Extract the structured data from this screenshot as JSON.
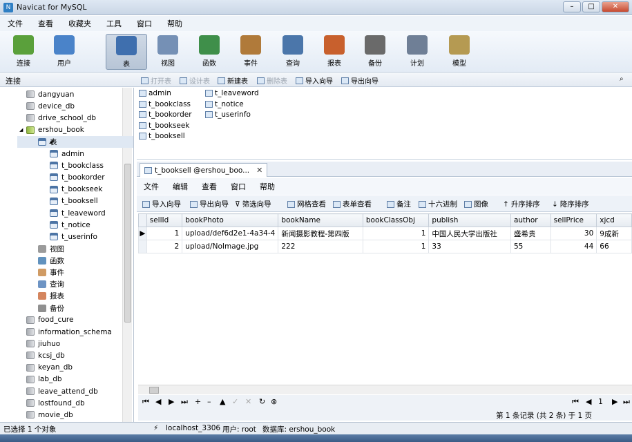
{
  "window": {
    "title": "Navicat for MySQL"
  },
  "menu": [
    "文件",
    "查看",
    "收藏夹",
    "工具",
    "窗口",
    "帮助"
  ],
  "toolbar": [
    {
      "label": "连接",
      "icon": "plug-icon",
      "color": "#5aa03b"
    },
    {
      "label": "用户",
      "icon": "user-icon",
      "color": "#4a83c9"
    },
    {
      "label": "表",
      "icon": "table-icon",
      "color": "#3f6fae",
      "active": true
    },
    {
      "label": "视图",
      "icon": "view-icon",
      "color": "#7590b5"
    },
    {
      "label": "函数",
      "icon": "function-icon",
      "color": "#3f8f4a"
    },
    {
      "label": "事件",
      "icon": "clock-icon",
      "color": "#b07a3a"
    },
    {
      "label": "查询",
      "icon": "query-icon",
      "color": "#4b76aa"
    },
    {
      "label": "报表",
      "icon": "report-icon",
      "color": "#c8602d"
    },
    {
      "label": "备份",
      "icon": "backup-icon",
      "color": "#6a6a6a"
    },
    {
      "label": "计划",
      "icon": "calendar-icon",
      "color": "#6f7f96"
    },
    {
      "label": "模型",
      "icon": "model-icon",
      "color": "#b59a52"
    }
  ],
  "objbar": {
    "conn_label": "连接",
    "buttons": [
      {
        "label": "打开表",
        "enabled": false
      },
      {
        "label": "设计表",
        "enabled": false
      },
      {
        "label": "新建表",
        "enabled": true
      },
      {
        "label": "删除表",
        "enabled": false
      },
      {
        "label": "导入向导",
        "enabled": true
      },
      {
        "label": "导出向导",
        "enabled": true
      }
    ]
  },
  "tree": [
    {
      "label": "dangyuan",
      "kind": "db",
      "level": 1
    },
    {
      "label": "device_db",
      "kind": "db",
      "level": 1
    },
    {
      "label": "drive_school_db",
      "kind": "db",
      "level": 1
    },
    {
      "label": "ershou_book",
      "kind": "db-open",
      "level": 1
    },
    {
      "label": "表",
      "kind": "folder",
      "level": 2
    },
    {
      "label": "admin",
      "kind": "table",
      "level": 3
    },
    {
      "label": "t_bookclass",
      "kind": "table",
      "level": 3
    },
    {
      "label": "t_bookorder",
      "kind": "table",
      "level": 3
    },
    {
      "label": "t_bookseek",
      "kind": "table",
      "level": 3
    },
    {
      "label": "t_booksell",
      "kind": "table",
      "level": 3
    },
    {
      "label": "t_leaveword",
      "kind": "table",
      "level": 3
    },
    {
      "label": "t_notice",
      "kind": "table",
      "level": 3
    },
    {
      "label": "t_userinfo",
      "kind": "table",
      "level": 3
    },
    {
      "label": "视图",
      "kind": "view",
      "level": 2
    },
    {
      "label": "函数",
      "kind": "func",
      "level": 2
    },
    {
      "label": "事件",
      "kind": "event",
      "level": 2
    },
    {
      "label": "查询",
      "kind": "query",
      "level": 2
    },
    {
      "label": "报表",
      "kind": "report",
      "level": 2
    },
    {
      "label": "备份",
      "kind": "backup",
      "level": 2
    },
    {
      "label": "food_cure",
      "kind": "db",
      "level": 1
    },
    {
      "label": "information_schema",
      "kind": "db",
      "level": 1
    },
    {
      "label": "jiuhuo",
      "kind": "db",
      "level": 1
    },
    {
      "label": "kcsj_db",
      "kind": "db",
      "level": 1
    },
    {
      "label": "keyan_db",
      "kind": "db",
      "level": 1
    },
    {
      "label": "lab_db",
      "kind": "db",
      "level": 1
    },
    {
      "label": "leave_attend_db",
      "kind": "db",
      "level": 1
    },
    {
      "label": "lostfound_db",
      "kind": "db",
      "level": 1
    },
    {
      "label": "movie_db",
      "kind": "db",
      "level": 1
    }
  ],
  "objects": {
    "col1": [
      "admin",
      "t_bookclass",
      "t_bookorder",
      "t_bookseek",
      "t_booksell"
    ],
    "col2": [
      "t_leaveword",
      "t_notice",
      "t_userinfo"
    ]
  },
  "tab": {
    "label": "t_booksell @ershou_boo...",
    "close": "✕"
  },
  "inner_menu": [
    "文件",
    "编辑",
    "查看",
    "窗口",
    "帮助"
  ],
  "inner_toolbar": [
    "导入向导",
    "导出向导",
    "筛选向导",
    "网格查看",
    "表单查看",
    "备注",
    "十六进制",
    "图像",
    "升序排序",
    "降序排序"
  ],
  "grid": {
    "columns": [
      "sellId",
      "bookPhoto",
      "bookName",
      "bookClassObj",
      "publish",
      "author",
      "sellPrice",
      "xjcd"
    ],
    "rows": [
      [
        "1",
        "upload/def6d2e1-4a34-4",
        "新闻摄影教程-第四版",
        "1",
        "中国人民大学出版社",
        "盛希贵",
        "30",
        "9成新"
      ],
      [
        "2",
        "upload/NoImage.jpg",
        "222",
        "1",
        "33",
        "55",
        "44",
        "66"
      ]
    ]
  },
  "nav": {
    "page": "1"
  },
  "record_info": "第 1 条记录 (共 2 条) 于 1 页",
  "status": {
    "selection": "已选择 1 个对象",
    "host": "localhost_3306",
    "user": "用户: root",
    "database": "数据库: ershou_book"
  }
}
